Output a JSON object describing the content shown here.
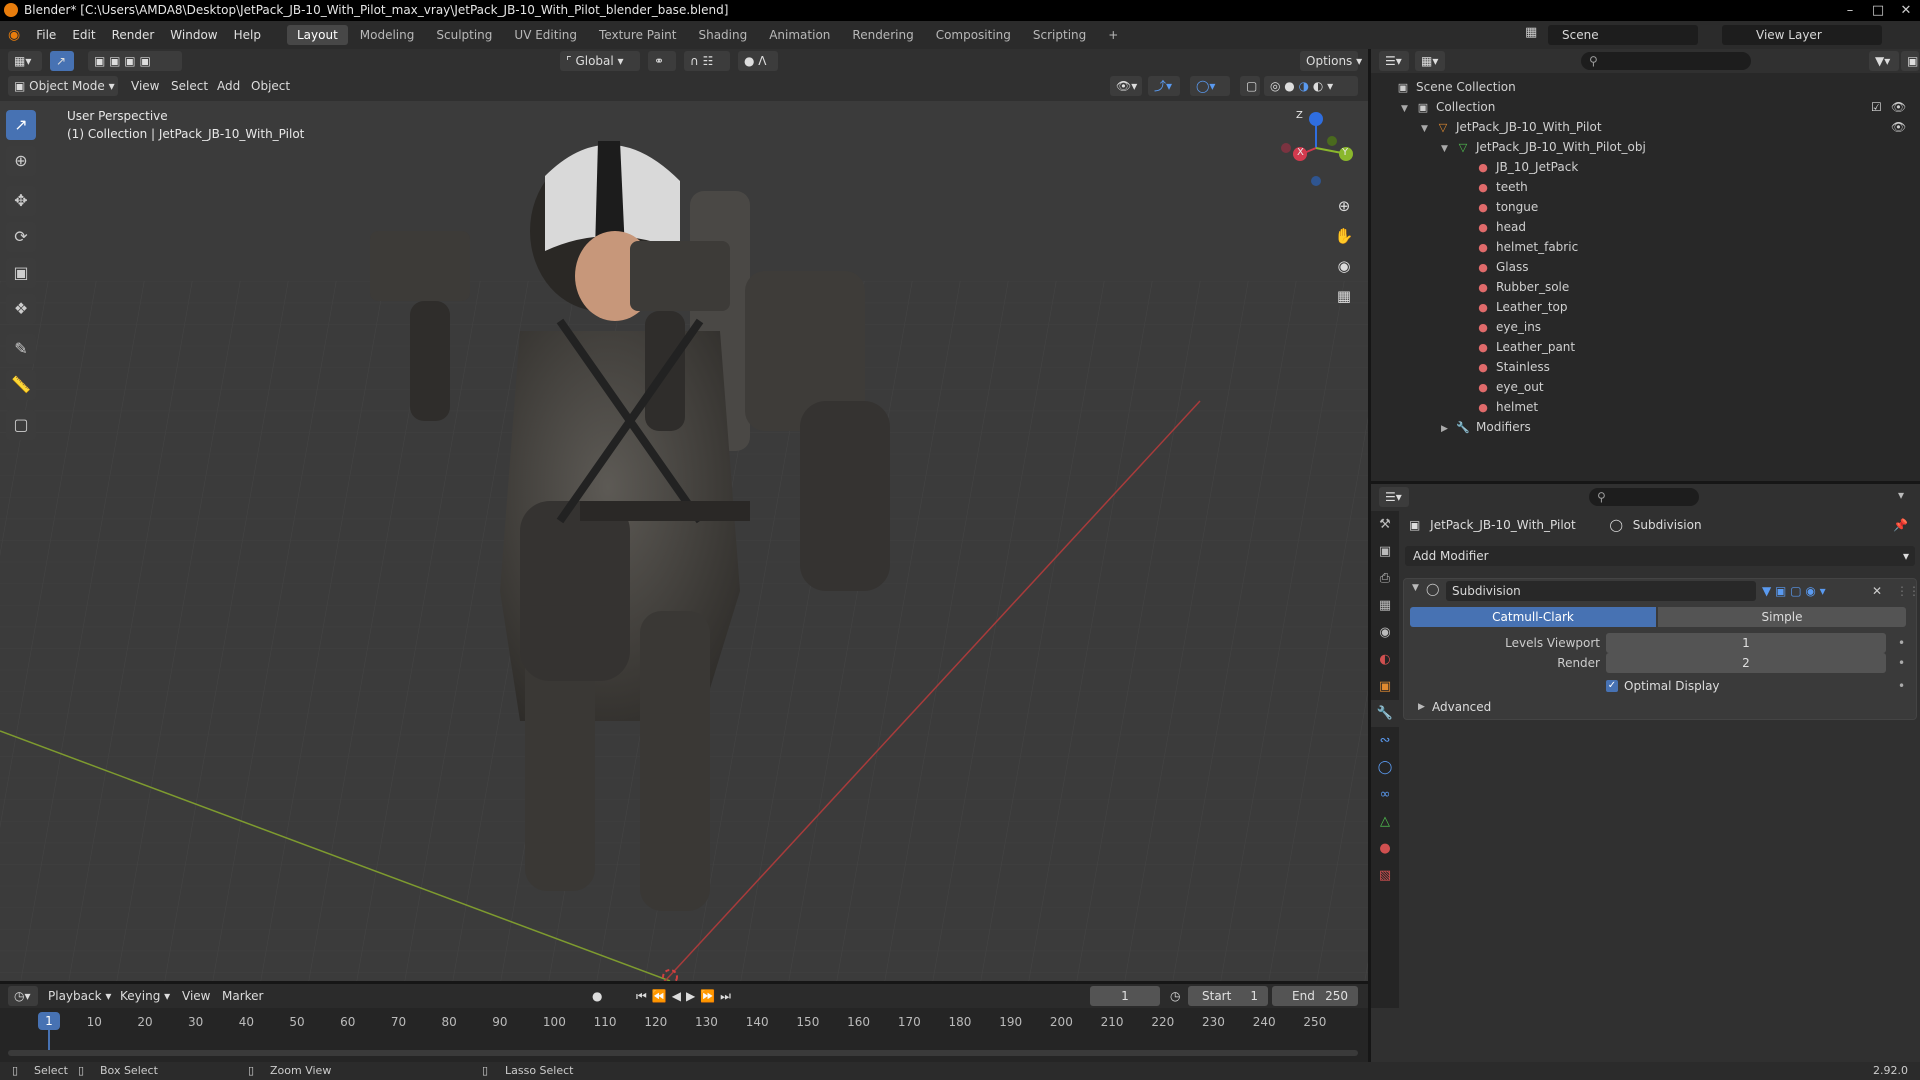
{
  "window": {
    "title": "Blender* [C:\\Users\\AMDA8\\Desktop\\JetPack_JB-10_With_Pilot_max_vray\\JetPack_JB-10_With_Pilot_blender_base.blend]",
    "controls": [
      "–",
      "□",
      "✕"
    ]
  },
  "menus": [
    "File",
    "Edit",
    "Render",
    "Window",
    "Help"
  ],
  "workspaces": [
    "Layout",
    "Modeling",
    "Sculpting",
    "UV Editing",
    "Texture Paint",
    "Shading",
    "Animation",
    "Rendering",
    "Compositing",
    "Scripting"
  ],
  "active_workspace": "Layout",
  "add_workspace": "+",
  "scene": {
    "name": "Scene",
    "view_layer": "View Layer"
  },
  "viewport": {
    "transform_orientation": "Global",
    "options": "Options",
    "mode": "Object Mode",
    "header_menus": [
      "View",
      "Select",
      "Add",
      "Object"
    ],
    "info_line1": "User Perspective",
    "info_line2": "(1) Collection | JetPack_JB-10_With_Pilot",
    "gizmo": {
      "x": "X",
      "y": "Y",
      "z": "Z"
    }
  },
  "outliner": {
    "rows": [
      {
        "label": "Scene Collection",
        "icon": "scene-collection-icon",
        "level": 0
      },
      {
        "label": "Collection",
        "icon": "collection-icon",
        "level": 1
      },
      {
        "label": "JetPack_JB-10_With_Pilot",
        "icon": "object-icon",
        "level": 2
      },
      {
        "label": "JetPack_JB-10_With_Pilot_obj",
        "icon": "mesh-icon",
        "level": 3
      },
      {
        "label": "JB_10_JetPack",
        "icon": "material-icon",
        "level": 4
      },
      {
        "label": "teeth",
        "icon": "material-icon",
        "level": 4
      },
      {
        "label": "tongue",
        "icon": "material-icon",
        "level": 4
      },
      {
        "label": "head",
        "icon": "material-icon",
        "level": 4
      },
      {
        "label": "helmet_fabric",
        "icon": "material-icon",
        "level": 4
      },
      {
        "label": "Glass",
        "icon": "material-icon",
        "level": 4
      },
      {
        "label": "Rubber_sole",
        "icon": "material-icon",
        "level": 4
      },
      {
        "label": "Leather_top",
        "icon": "material-icon",
        "level": 4
      },
      {
        "label": "eye_ins",
        "icon": "material-icon",
        "level": 4
      },
      {
        "label": "Leather_pant",
        "icon": "material-icon",
        "level": 4
      },
      {
        "label": "Stainless",
        "icon": "material-icon",
        "level": 4
      },
      {
        "label": "eye_out",
        "icon": "material-icon",
        "level": 4
      },
      {
        "label": "helmet",
        "icon": "material-icon",
        "level": 4
      },
      {
        "label": "Modifiers",
        "icon": "wrench-icon",
        "level": 3
      }
    ]
  },
  "properties": {
    "object_name": "JetPack_JB-10_With_Pilot",
    "modifier_breadcrumb": "Subdivision",
    "add_modifier": "Add Modifier",
    "modifier_name": "Subdivision",
    "algo_options": [
      "Catmull-Clark",
      "Simple"
    ],
    "algo_selected": "Catmull-Clark",
    "levels_viewport_label": "Levels Viewport",
    "levels_viewport": "1",
    "render_label": "Render",
    "render": "2",
    "optimal_display_label": "Optimal Display",
    "optimal_display": true,
    "advanced_label": "Advanced"
  },
  "timeline": {
    "menus": [
      "Playback",
      "Keying",
      "View",
      "Marker"
    ],
    "current_frame": "1",
    "start_label": "Start",
    "start": "1",
    "end_label": "End",
    "end": "250",
    "ticks": [
      "10",
      "20",
      "30",
      "40",
      "50",
      "60",
      "70",
      "80",
      "90",
      "100",
      "110",
      "120",
      "130",
      "140",
      "150",
      "160",
      "170",
      "180",
      "190",
      "200",
      "210",
      "220",
      "230",
      "240",
      "250"
    ],
    "playhead": "1"
  },
  "statusbar": {
    "select": "Select",
    "box_select": "Box Select",
    "zoom_view": "Zoom View",
    "lasso_select": "Lasso Select",
    "version": "2.92.0"
  }
}
